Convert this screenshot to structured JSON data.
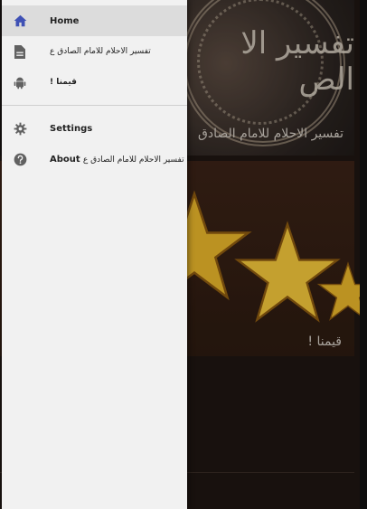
{
  "background": {
    "card_top": {
      "caption": "تفسير الاحلام للامام الصادق",
      "big_title": "تفسير الا\nالص"
    },
    "card_stars": {
      "caption": "قيمنا !"
    }
  },
  "drawer": {
    "primary_items": [
      {
        "label": "Home",
        "icon": "home-icon",
        "active": true
      },
      {
        "label": "تفسير الاحلام للامام الصادق ع",
        "icon": "document-icon",
        "active": false
      },
      {
        "label": "قيمنا !",
        "icon": "android-icon",
        "active": false
      }
    ],
    "settings_label": "Settings",
    "about": {
      "label": "About",
      "suffix": "تفسير الاحلام للامام الصادق ع"
    }
  },
  "colors": {
    "active_icon": "#3f51b5",
    "icon": "#616161",
    "drawer_bg": "#f1f1f1",
    "active_row_bg": "#dcdcdc",
    "star": "#e5b22a"
  }
}
